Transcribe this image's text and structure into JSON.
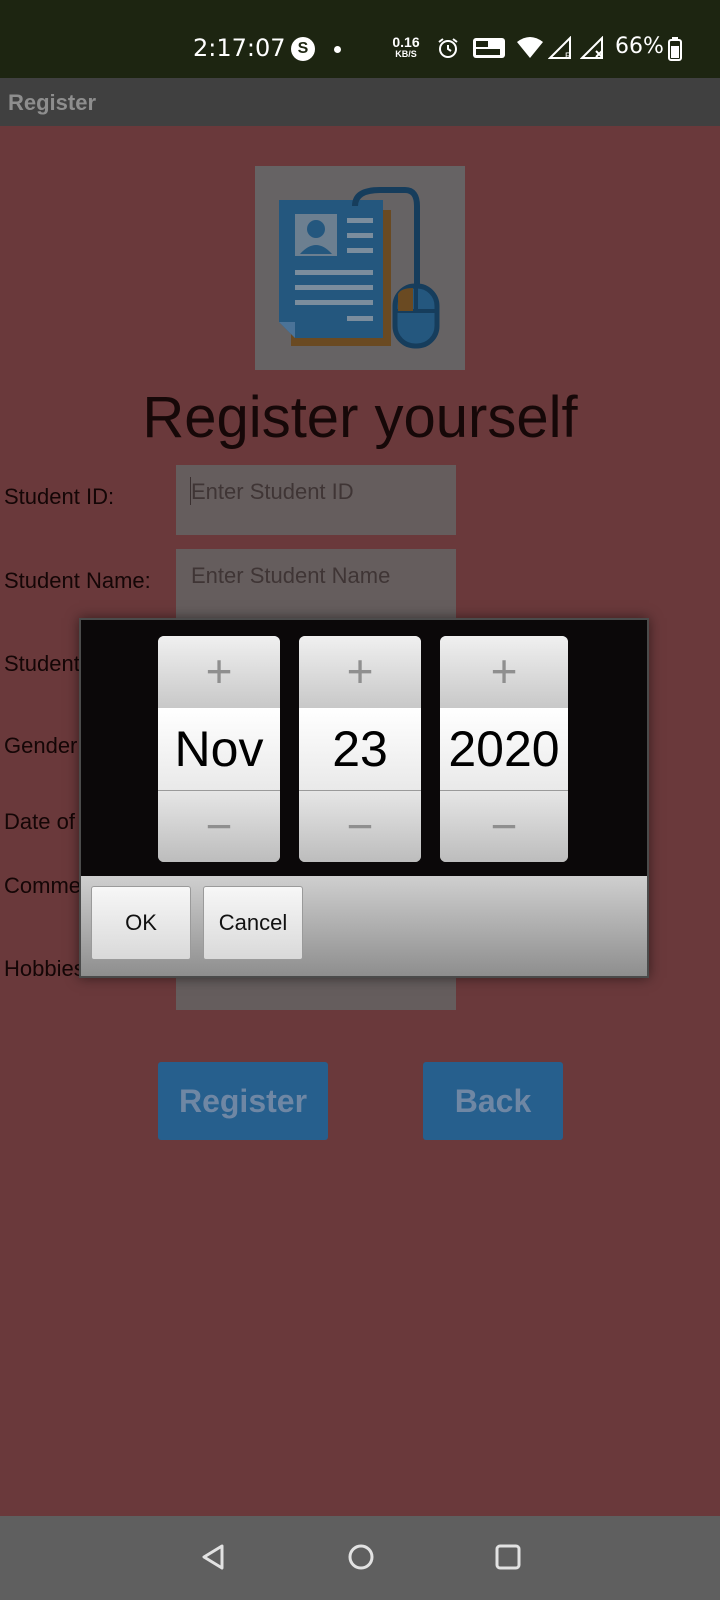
{
  "status_bar": {
    "time": "2:17:07",
    "s_badge": "S",
    "speed_value": "0.16",
    "speed_unit": "KB/S",
    "battery": "66%"
  },
  "app_bar": {
    "title": "Register"
  },
  "form": {
    "heading": "Register yourself",
    "labels": {
      "student_id": "Student ID:",
      "student_name": "Student Name:",
      "student_age": "Student Age:",
      "gender": "Gender:",
      "date_of_birth": "Date of Birth:",
      "comments": "Comments:",
      "hobbies": "Hobbies:"
    },
    "placeholders": {
      "student_id": "Enter Student ID",
      "student_name": "Enter Student Name"
    },
    "register_label": "Register",
    "back_label": "Back"
  },
  "date_picker": {
    "month": "Nov",
    "day": "23",
    "year": "2020",
    "plus_glyph": "+",
    "minus_glyph": "−",
    "ok_label": "OK",
    "cancel_label": "Cancel"
  },
  "icons": {
    "status": [
      "s-app-icon",
      "notification-dot-icon",
      "alarm-icon",
      "vowifi-icon",
      "wifi-icon",
      "signal-r-icon",
      "signal-x-icon",
      "battery-icon"
    ],
    "nav": [
      "back-icon",
      "home-icon",
      "recents-icon"
    ]
  },
  "colors": {
    "scrim_background": "#6a393b",
    "status_bar": "#1d2511",
    "button_blue": "#265f8d"
  }
}
